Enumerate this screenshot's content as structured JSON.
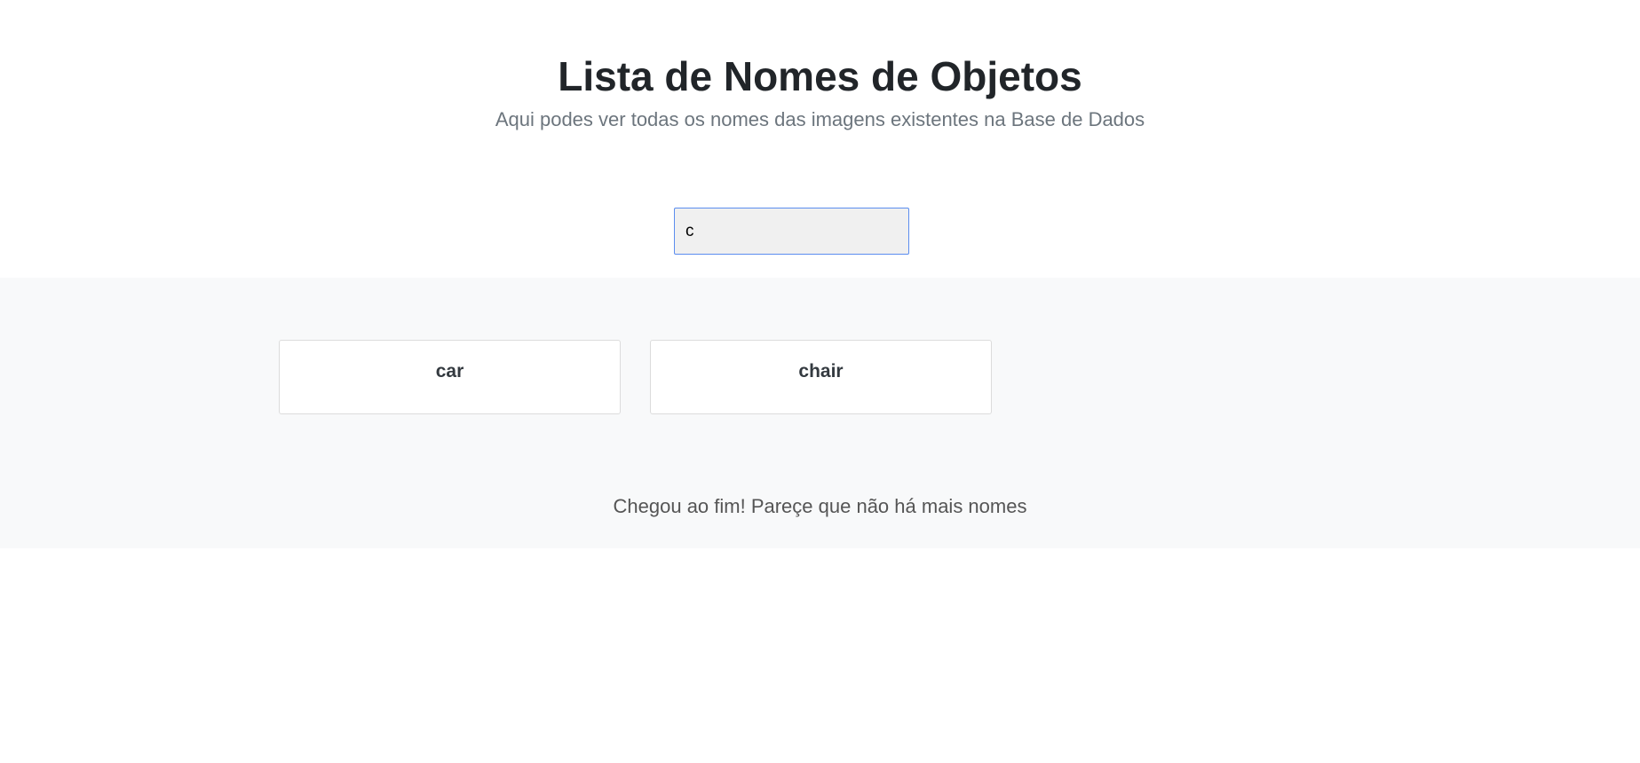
{
  "header": {
    "title": "Lista de Nomes de Objetos",
    "subtitle": "Aqui podes ver todas os nomes das imagens existentes na Base de Dados"
  },
  "search": {
    "value": "c",
    "placeholder": ""
  },
  "results": {
    "items": [
      {
        "label": "car"
      },
      {
        "label": "chair"
      }
    ],
    "end_message": "Chegou ao fim! Pareçe que não há mais nomes"
  },
  "colors": {
    "accent_border": "#5b8def",
    "results_background": "#f8f9fa",
    "title_text": "#212529",
    "muted_text": "#6c757d"
  }
}
